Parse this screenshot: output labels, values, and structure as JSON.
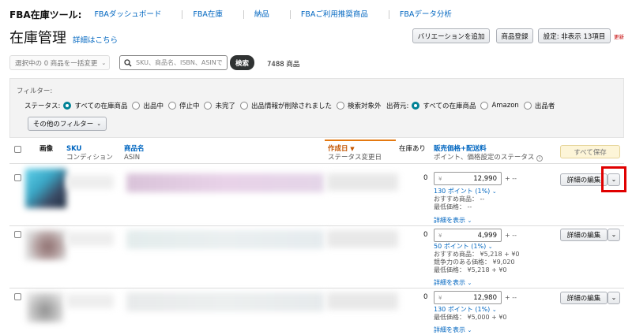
{
  "topnav": {
    "brand": "FBA在庫ツール:",
    "items": [
      "FBAダッシュボード",
      "FBA在庫",
      "納品",
      "FBAご利用推奨商品",
      "FBAデータ分析"
    ]
  },
  "header": {
    "title": "在庫管理",
    "learn_more": "詳細はこちら",
    "add_variation": "バリエーションを追加",
    "add_product": "商品登録",
    "settings": "設定: 非表示 13項目",
    "update": "更新"
  },
  "toolbar": {
    "bulk_action": "選択中の 0 商品を一括変更",
    "search_placeholder": "SKU、商品名、ISBN、ASINで",
    "search_button": "検索",
    "count": "7488 商品"
  },
  "filters": {
    "label": "フィルター:",
    "status_label": "ステータス:",
    "status_options": [
      "すべての在庫商品",
      "出品中",
      "停止中",
      "未完了",
      "出品情報が削除されました",
      "検索対象外"
    ],
    "channel_label": "出荷元:",
    "channel_options": [
      "すべての在庫商品",
      "Amazon",
      "出品者"
    ],
    "more": "その他のフィルター"
  },
  "table": {
    "headers": {
      "image": "画像",
      "sku": "SKU",
      "condition": "コンディション",
      "name": "商品名",
      "asin": "ASIN",
      "created": "作成日",
      "status_changed": "ステータス変更日",
      "in_stock": "在庫あり",
      "price": "販売価格+配送料",
      "price_sub": "ポイント、価格設定のステータス",
      "save_all": "すべて保存"
    },
    "rows": [
      {
        "stock": "0",
        "currency": "¥",
        "price": "12,990",
        "shipping": "+ --",
        "points": "130 ポイント (1%)",
        "recommended": "おすすめ商品： --",
        "competitive": "",
        "lowest": "最低価格： --",
        "details": "詳細を表示",
        "edit": "詳細の編集"
      },
      {
        "stock": "0",
        "currency": "¥",
        "price": "4,999",
        "shipping": "+ --",
        "points": "50 ポイント (1%)",
        "recommended": "おすすめ商品： ¥5,218 + ¥0",
        "competitive": "競争力のある価格： ¥9,020",
        "lowest": "最低価格： ¥5,218 + ¥0",
        "details": "詳細を表示",
        "edit": "詳細の編集"
      },
      {
        "stock": "0",
        "currency": "¥",
        "price": "12,980",
        "shipping": "+ --",
        "points": "130 ポイント (1%)",
        "recommended": "",
        "competitive": "",
        "lowest": "最低価格： ¥5,000 + ¥0",
        "details": "詳細を表示",
        "edit": "詳細の編集"
      }
    ]
  },
  "highlight_color": "#e00000"
}
